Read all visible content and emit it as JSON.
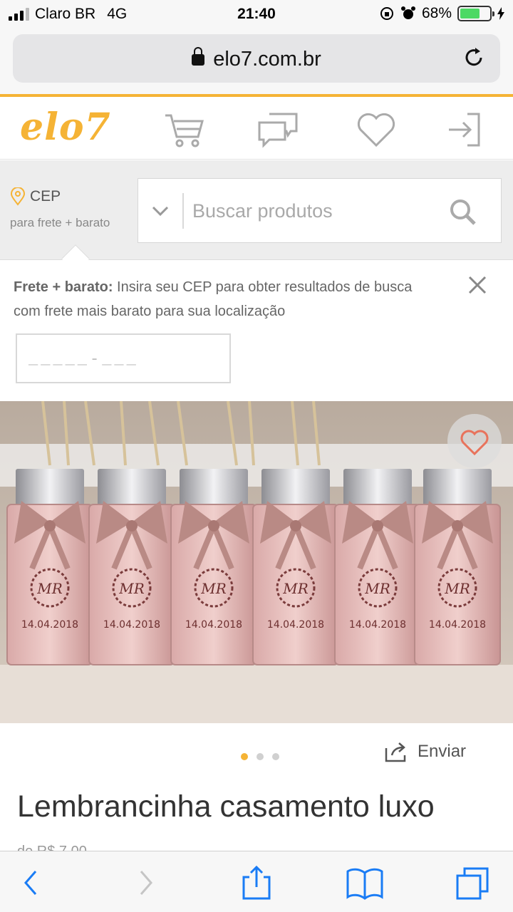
{
  "status_bar": {
    "carrier": "Claro BR",
    "network": "4G",
    "time": "21:40",
    "battery_percent": "68%",
    "battery_level": 0.68
  },
  "browser": {
    "url": "elo7.com.br"
  },
  "site": {
    "logo": "elo7",
    "brand_color": "#f5b335",
    "header_icons": [
      "cart-icon",
      "chat-icon",
      "heart-icon",
      "login-icon"
    ]
  },
  "search": {
    "cep_label": "CEP",
    "cep_sublabel": "para frete + barato",
    "placeholder": "Buscar produtos"
  },
  "cep_panel": {
    "bold": "Frete + barato:",
    "message": " Insira seu CEP para obter resultados de busca com frete mais barato para sua localização",
    "input_placeholder": "_____-___"
  },
  "product": {
    "engraved_date": "14.04.2018",
    "carousel_total": 3,
    "carousel_active": 1,
    "share_label": "Enviar",
    "title": "Lembrancinha casamento luxo",
    "price_partial": "de R$ 7,00"
  }
}
